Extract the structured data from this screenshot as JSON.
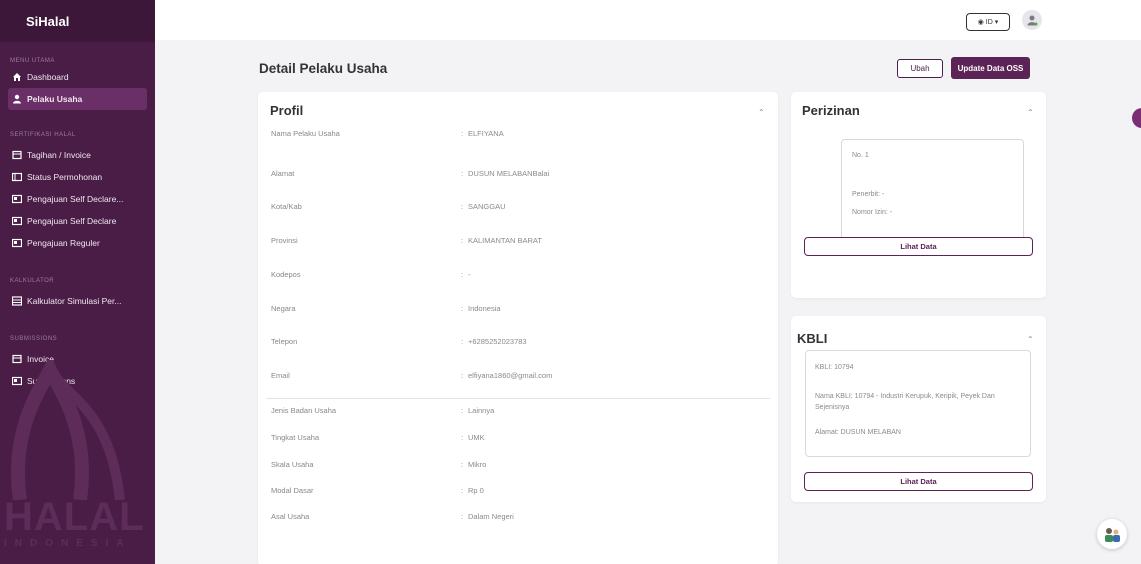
{
  "sidebar": {
    "brand": "SiHalal",
    "menu_label": "MENU UTAMA",
    "cert_label": "SERTIFIKASI HALAL",
    "calc_label": "KALKULATOR",
    "sub_label": "SUBMISSIONS",
    "items": [
      {
        "label": "Dashboard",
        "icon": "home-icon"
      },
      {
        "label": "Pelaku Usaha",
        "icon": "user-icon"
      },
      {
        "label": "Tagihan / Invoice",
        "icon": "invoice-icon"
      },
      {
        "label": "Status Permohonan",
        "icon": "status-icon"
      },
      {
        "label": "Pengajuan Self Declare...",
        "icon": "declare-icon"
      },
      {
        "label": "Pengajuan Self Declare",
        "icon": "declare-icon"
      },
      {
        "label": "Pengajuan Reguler",
        "icon": "regular-icon"
      },
      {
        "label": "Kalkulator Simulasi Per...",
        "icon": "calculator-icon"
      },
      {
        "label": "Invoice",
        "icon": "invoice-icon"
      },
      {
        "label": "Submissions",
        "icon": "submissions-icon"
      }
    ],
    "watermark": "HALAL",
    "watermark_sub": "INDONESIA"
  },
  "topbar": {
    "lang": "ID"
  },
  "page": {
    "title": "Detail Pelaku Usaha",
    "btn_ubah": "Ubah",
    "btn_oss": "Update Data OSS"
  },
  "profil": {
    "title": "Profil",
    "rows": [
      {
        "label": "Nama Pelaku Usaha",
        "value": "ELFIYANA"
      },
      {
        "label": "Alamat",
        "value": "DUSUN MELABANBalai"
      },
      {
        "label": "Kota/Kab",
        "value": "SANGGAU"
      },
      {
        "label": "Provinsi",
        "value": "KALIMANTAN BARAT"
      },
      {
        "label": "Kodepos",
        "value": "-"
      },
      {
        "label": "Negara",
        "value": "Indonesia"
      },
      {
        "label": "Telepon",
        "value": "+6285252023783"
      },
      {
        "label": "Email",
        "value": "elfiyana1860@gmail.com"
      },
      {
        "label": "Jenis Badan Usaha",
        "value": "Lainnya"
      },
      {
        "label": "Tingkat Usaha",
        "value": "UMK"
      },
      {
        "label": "Skala Usaha",
        "value": "Mikro"
      },
      {
        "label": "Modal Dasar",
        "value": "Rp 0"
      },
      {
        "label": "Asal Usaha",
        "value": "Dalam Negeri"
      }
    ],
    "colon": ":"
  },
  "perizinan": {
    "title": "Perizinan",
    "no": "No. 1",
    "penerbit": "Penerbit: -",
    "nomor": "Nomor Izin: -",
    "btn": "Lihat Data"
  },
  "kbli": {
    "title": "KBLI",
    "code": "KBLI: 10794",
    "name": "Nama KBLI: 10794 - Industri Kerupuk, Keripik, Peyek Dan Sejenisnya",
    "alamat": "Alamat: DUSUN MELABAN",
    "btn": "Lihat Data"
  },
  "colors": {
    "sidebar": "#4a1d47",
    "accent": "#5c2357"
  }
}
